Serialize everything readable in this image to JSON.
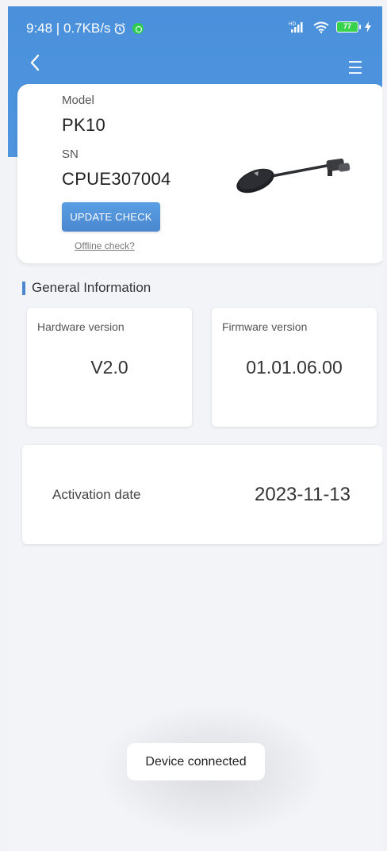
{
  "status_bar": {
    "time_speed": "9:48 | 0.7KB/s",
    "battery_level": "77",
    "icons": [
      "alarm-icon",
      "app-notification-icon",
      "signal-icon",
      "wifi-icon",
      "battery-icon",
      "charging-icon"
    ]
  },
  "nav": {
    "back_icon": "chevron-left-icon",
    "menu_icon": "menu-icon"
  },
  "device": {
    "model_label": "Model",
    "model_value": "PK10",
    "sn_label": "SN",
    "sn_value": "CPUE307004",
    "update_button": "UPDATE CHECK",
    "offline_link": "Offline check?"
  },
  "general_info": {
    "title": "General Information",
    "hardware_label": "Hardware version",
    "hardware_value": "V2.0",
    "firmware_label": "Firmware version",
    "firmware_value": "01.01.06.00",
    "activation_label": "Activation date",
    "activation_value": "2023-11-13"
  },
  "toast": {
    "message": "Device connected"
  },
  "colors": {
    "header_blue": "#4a90db",
    "accent_blue": "#4a87cf",
    "background": "#f3f4f8"
  }
}
